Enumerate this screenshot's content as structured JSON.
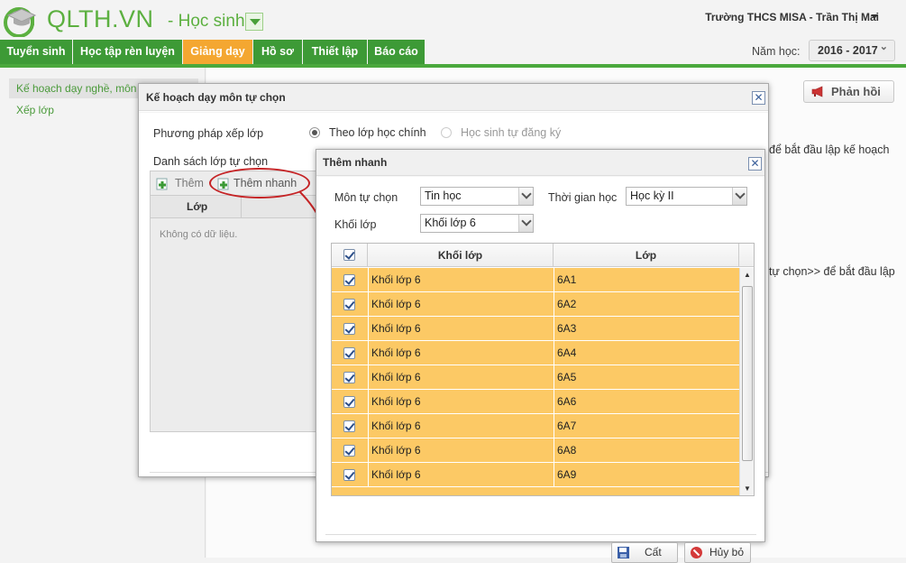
{
  "brand": {
    "logo_text": "QLTH.VN",
    "role": "- Học sinh"
  },
  "user": {
    "info": "Trường THCS MISA - Trần Thị Mai"
  },
  "nav": {
    "items": [
      {
        "label": "Tuyển sinh"
      },
      {
        "label": "Học tập rèn luyện"
      },
      {
        "label": "Giảng dạy"
      },
      {
        "label": "Hồ sơ"
      },
      {
        "label": "Thiết lập"
      },
      {
        "label": "Báo cáo"
      }
    ],
    "active_index": 2
  },
  "year": {
    "label": "Năm học:",
    "value": "2016 - 2017"
  },
  "sidebar": {
    "items": [
      {
        "label": "Kế hoạch dạy nghề, môn"
      },
      {
        "label": "Xếp lớp"
      }
    ]
  },
  "feedback": {
    "label": "Phản hồi"
  },
  "background_text": {
    "note1": "để bắt đầu lập kế hoạch",
    "note2": "tự chọn>> để bắt đầu lập"
  },
  "dialog1": {
    "title": "Kế hoạch dạy môn tự chọn",
    "method_label": "Phương pháp xếp lớp",
    "option1": "Theo lớp học chính",
    "option2": "Học sinh tự đăng ký",
    "list_label": "Danh sách lớp tự chọn",
    "add_label": "Thêm",
    "quick_add_label": "Thêm nhanh",
    "col_class": "Lớp",
    "empty_text": "Không có dữ liệu."
  },
  "dialog2": {
    "title": "Thêm nhanh",
    "subject_label": "Môn tự chọn",
    "subject_value": "Tin học",
    "time_label": "Thời gian học",
    "time_value": "Học kỳ II",
    "grade_label": "Khối lớp",
    "grade_value": "Khối lớp 6",
    "columns": {
      "grade": "Khối lớp",
      "class": "Lớp"
    },
    "rows": [
      {
        "grade": "Khối lớp 6",
        "class": "6A1",
        "checked": true
      },
      {
        "grade": "Khối lớp 6",
        "class": "6A2",
        "checked": true
      },
      {
        "grade": "Khối lớp 6",
        "class": "6A3",
        "checked": true
      },
      {
        "grade": "Khối lớp 6",
        "class": "6A4",
        "checked": true
      },
      {
        "grade": "Khối lớp 6",
        "class": "6A5",
        "checked": true
      },
      {
        "grade": "Khối lớp 6",
        "class": "6A6",
        "checked": true
      },
      {
        "grade": "Khối lớp 6",
        "class": "6A7",
        "checked": true
      },
      {
        "grade": "Khối lớp 6",
        "class": "6A8",
        "checked": true
      },
      {
        "grade": "Khối lớp 6",
        "class": "6A9",
        "checked": true
      }
    ],
    "save_label": "Cất",
    "cancel_label": "Hủy bỏ"
  },
  "colors": {
    "nav_green": "#3d9a36",
    "nav_active": "#f4a731",
    "row_highlight": "#fcc965",
    "brand_green": "#5cb040",
    "annotation_red": "#c52426"
  }
}
